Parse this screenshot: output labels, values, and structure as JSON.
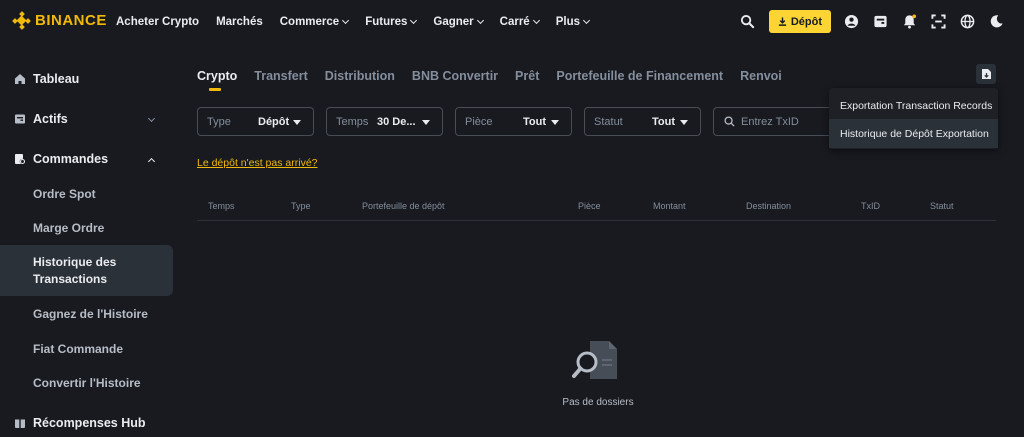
{
  "brand": {
    "name": "BINANCE"
  },
  "nav": {
    "items": [
      {
        "label": "Acheter Crypto"
      },
      {
        "label": "Marchés"
      },
      {
        "label": "Commerce"
      },
      {
        "label": "Futures"
      },
      {
        "label": "Gagner"
      },
      {
        "label": "Carré"
      },
      {
        "label": "Plus"
      }
    ],
    "deposit_label": "Dépôt"
  },
  "sidebar": {
    "items": [
      {
        "label": "Tableau"
      },
      {
        "label": "Actifs"
      },
      {
        "label": "Commandes"
      },
      {
        "label": "Ordre Spot"
      },
      {
        "label": "Marge Ordre"
      },
      {
        "label": "Historique des Transactions"
      },
      {
        "label": "Gagnez de l'Histoire"
      },
      {
        "label": "Fiat Commande"
      },
      {
        "label": "Convertir l'Histoire"
      },
      {
        "label": "Récompenses Hub"
      }
    ]
  },
  "tabs": [
    {
      "label": "Crypto"
    },
    {
      "label": "Transfert"
    },
    {
      "label": "Distribution"
    },
    {
      "label": "BNB Convertir"
    },
    {
      "label": "Prêt"
    },
    {
      "label": "Portefeuille de Financement"
    },
    {
      "label": "Renvoi"
    }
  ],
  "filters": {
    "type": {
      "label": "Type",
      "value": "Dépôt"
    },
    "time": {
      "label": "Temps",
      "value": "30 De..."
    },
    "coin": {
      "label": "Pièce",
      "value": "Tout"
    },
    "status": {
      "label": "Statut",
      "value": "Tout"
    },
    "txid": {
      "placeholder": "Entrez TxID"
    }
  },
  "export_menu": {
    "items": [
      {
        "label": "Exportation Transaction Records"
      },
      {
        "label": "Historique de Dépôt Exportation"
      }
    ]
  },
  "not_arrived_link": "Le dépôt n'est pas arrivé?",
  "table": {
    "columns": [
      "Temps",
      "Type",
      "Portefeuille de dépôt",
      "Pièce",
      "Montant",
      "Destination",
      "TxID",
      "Statut"
    ]
  },
  "empty_state": {
    "text": "Pas de dossiers"
  },
  "colors": {
    "accent": "#f0b90b",
    "background": "#181a20",
    "surface": "#2b3139"
  }
}
